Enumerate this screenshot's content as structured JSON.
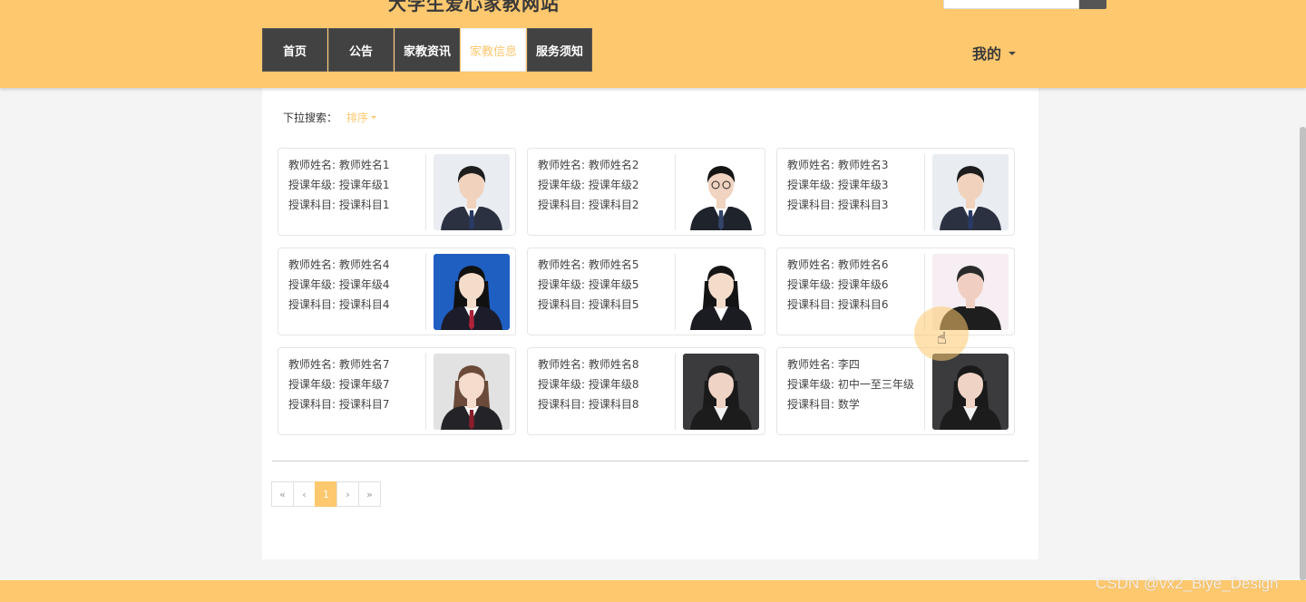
{
  "colors": {
    "accent": "#fdc86e",
    "nav_bg": "#424242"
  },
  "header": {
    "site_title": "大学生爱心家教网站",
    "nav": [
      {
        "label": "首页",
        "active": false
      },
      {
        "label": "公告",
        "active": false
      },
      {
        "label": "家教资讯",
        "active": false
      },
      {
        "label": "家教信息",
        "active": true
      },
      {
        "label": "服务须知",
        "active": false
      }
    ],
    "user_menu_label": "我的"
  },
  "filter": {
    "label": "下拉搜索：",
    "sort_label": "排序"
  },
  "cards": [
    {
      "name_label": "教师姓名:",
      "name": "教师姓名1",
      "grade_label": "授课年级:",
      "grade": "授课年级1",
      "subject_label": "授课科目:",
      "subject": "授课科目1",
      "photo": "male-suit"
    },
    {
      "name_label": "教师姓名:",
      "name": "教师姓名2",
      "grade_label": "授课年级:",
      "grade": "授课年级2",
      "subject_label": "授课科目:",
      "subject": "授课科目2",
      "photo": "male-glasses"
    },
    {
      "name_label": "教师姓名:",
      "name": "教师姓名3",
      "grade_label": "授课年级:",
      "grade": "授课年级3",
      "subject_label": "授课科目:",
      "subject": "授课科目3",
      "photo": "male-suit"
    },
    {
      "name_label": "教师姓名:",
      "name": "教师姓名4",
      "grade_label": "授课年级:",
      "grade": "授课年级4",
      "subject_label": "授课科目:",
      "subject": "授课科目4",
      "photo": "female-blue"
    },
    {
      "name_label": "教师姓名:",
      "name": "教师姓名5",
      "grade_label": "授课年级:",
      "grade": "授课年级5",
      "subject_label": "授课科目:",
      "subject": "授课科目5",
      "photo": "female-suit"
    },
    {
      "name_label": "教师姓名:",
      "name": "教师姓名6",
      "grade_label": "授课年级:",
      "grade": "授课年级6",
      "subject_label": "授课科目:",
      "subject": "授课科目6",
      "photo": "male-casual"
    },
    {
      "name_label": "教师姓名:",
      "name": "教师姓名7",
      "grade_label": "授课年级:",
      "grade": "授课年级7",
      "subject_label": "授课科目:",
      "subject": "授课科目7",
      "photo": "female-longhair"
    },
    {
      "name_label": "教师姓名:",
      "name": "教师姓名8",
      "grade_label": "授课年级:",
      "grade": "授课年级8",
      "subject_label": "授课科目:",
      "subject": "授课科目8",
      "photo": "female-dark"
    },
    {
      "name_label": "教师姓名:",
      "name": "李四",
      "grade_label": "授课年级:",
      "grade": "初中一至三年级",
      "subject_label": "授课科目:",
      "subject": "数学",
      "photo": "female-dark"
    }
  ],
  "pagination": {
    "first": "«",
    "prev": "‹",
    "current": "1",
    "next": "›",
    "last": "»"
  },
  "watermark": "CSDN @vx2_Biye_Design"
}
